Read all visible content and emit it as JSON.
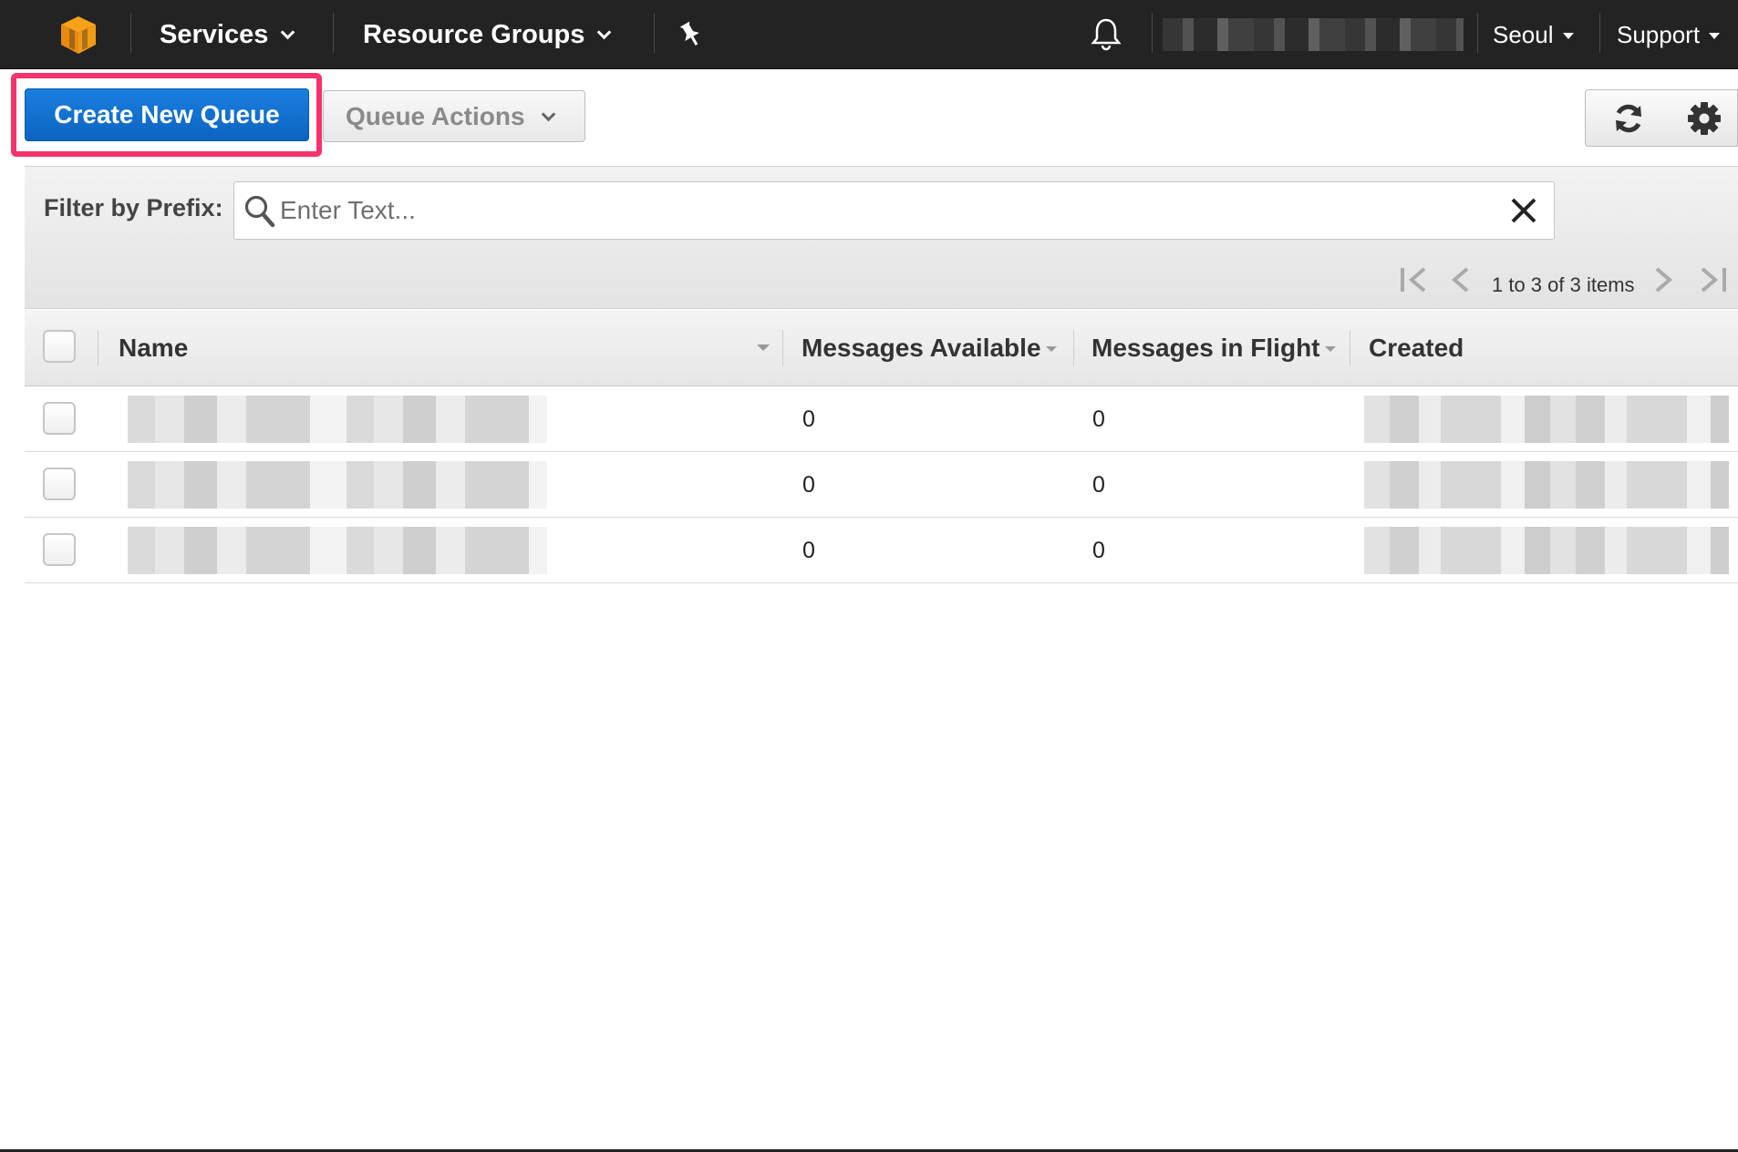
{
  "nav": {
    "services_label": "Services",
    "resource_groups_label": "Resource Groups",
    "region_label": "Seoul",
    "support_label": "Support",
    "logo_icon": "aws-cube-icon",
    "pin_icon": "pushpin-icon",
    "bell_icon": "bell-icon"
  },
  "toolbar": {
    "create_label": "Create New Queue",
    "actions_label": "Queue Actions",
    "refresh_icon": "refresh-icon",
    "settings_icon": "gear-icon",
    "highlight_color": "#f4326c",
    "primary_color": "#0d6fd6"
  },
  "filter": {
    "label": "Filter by Prefix:",
    "placeholder": "Enter Text...",
    "value": ""
  },
  "pagination": {
    "text": "1 to 3 of 3 items"
  },
  "table": {
    "columns": [
      "Name",
      "Messages Available",
      "Messages in Flight",
      "Created"
    ],
    "rows": [
      {
        "available": "0",
        "in_flight": "0"
      },
      {
        "available": "0",
        "in_flight": "0"
      },
      {
        "available": "0",
        "in_flight": "0"
      }
    ]
  }
}
